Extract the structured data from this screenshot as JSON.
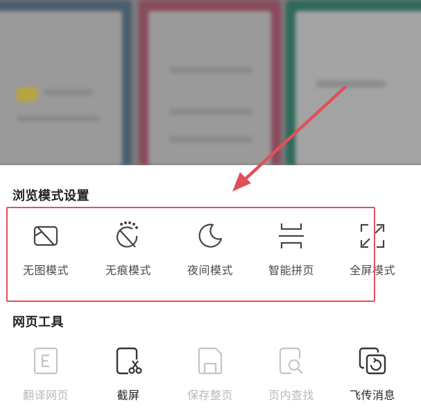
{
  "sections": {
    "browse_mode": {
      "title": "浏览模式设置",
      "items": [
        {
          "label": "无图模式",
          "icon": "no-image-icon"
        },
        {
          "label": "无痕模式",
          "icon": "incognito-icon"
        },
        {
          "label": "夜间模式",
          "icon": "moon-icon"
        },
        {
          "label": "智能拼页",
          "icon": "page-join-icon"
        },
        {
          "label": "全屏模式",
          "icon": "fullscreen-icon"
        }
      ]
    },
    "web_tools": {
      "title": "网页工具",
      "items": [
        {
          "label": "翻译网页",
          "icon": "translate-icon",
          "enabled": false
        },
        {
          "label": "截屏",
          "icon": "screenshot-icon",
          "enabled": true
        },
        {
          "label": "保存整页",
          "icon": "save-page-icon",
          "enabled": false
        },
        {
          "label": "页内查找",
          "icon": "find-in-page-icon",
          "enabled": false
        },
        {
          "label": "飞传消息",
          "icon": "send-message-icon",
          "enabled": true
        }
      ]
    }
  },
  "colors": {
    "highlight": "#e0505a",
    "arrow": "#e0505a",
    "text": "#222222",
    "icon": "#444444",
    "disabled": "#c4c4c4"
  }
}
